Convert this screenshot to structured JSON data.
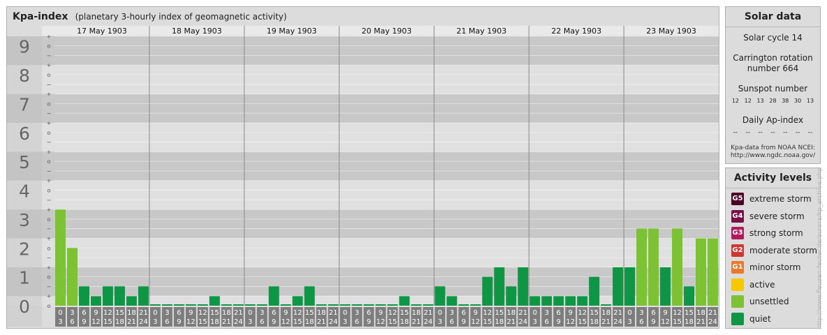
{
  "header": {
    "title": "Kpa-index",
    "subtitle": "(planetary 3-hourly index of geomagnetic activity)"
  },
  "chart_data": {
    "type": "bar",
    "days": [
      "17 May 1903",
      "18 May 1903",
      "19 May 1903",
      "20 May 1903",
      "21 May 1903",
      "22 May 1903",
      "23 May 1903"
    ],
    "hour_labels": [
      [
        "0",
        "3"
      ],
      [
        "3",
        "6"
      ],
      [
        "6",
        "9"
      ],
      [
        "9",
        "12"
      ],
      [
        "12",
        "15"
      ],
      [
        "15",
        "18"
      ],
      [
        "18",
        "21"
      ],
      [
        "21",
        "24"
      ]
    ],
    "y_ticks": [
      "0",
      "1",
      "2",
      "3",
      "4",
      "5",
      "6",
      "7",
      "8",
      "9"
    ],
    "minor_marks": [
      "o",
      "+",
      "−"
    ],
    "ylim": [
      0,
      9.33
    ],
    "values": [
      3.33,
      2.0,
      0.67,
      0.33,
      0.67,
      0.67,
      0.33,
      0.67,
      0,
      0,
      0,
      0,
      0,
      0.33,
      0,
      0,
      0,
      0,
      0.67,
      0,
      0.33,
      0.67,
      0,
      0,
      0,
      0,
      0,
      0,
      0,
      0.33,
      0,
      0,
      0.67,
      0.33,
      0,
      0,
      1.0,
      1.33,
      0.67,
      1.33,
      0.33,
      0.33,
      0.33,
      0.33,
      0.33,
      1.0,
      0,
      1.33,
      1.33,
      2.67,
      2.67,
      1.33,
      2.67,
      0.67,
      2.33,
      2.33
    ],
    "colors": {
      "quiet": "#0e9645",
      "unsettled": "#7cc232",
      "active": "#f7c702",
      "minor": "#e9782e",
      "moderate": "#d0362e",
      "strong": "#b0195c",
      "severe": "#7a0e46",
      "extreme": "#4c0026"
    }
  },
  "solar": {
    "title": "Solar data",
    "cycle": "Solar cycle 14",
    "carrington_1": "Carrington rotation",
    "carrington_2": "number 664",
    "sunspot_title": "Sunspot number",
    "sunspots": [
      "12",
      "12",
      "13",
      "28",
      "38",
      "30",
      "13"
    ],
    "ap_title": "Daily Ap-index",
    "ap_values": [
      "--",
      "--",
      "--",
      "--",
      "--",
      "--",
      "--"
    ],
    "source_1": "Kpa-data from NOAA NCEI:",
    "source_2": "http://www.ngdc.noaa.gov/"
  },
  "levels": {
    "title": "Activity levels",
    "items": [
      {
        "badge": "G5",
        "label": "extreme storm",
        "color": "#4c0026"
      },
      {
        "badge": "G4",
        "label": "severe storm",
        "color": "#7a0e46"
      },
      {
        "badge": "G3",
        "label": "strong storm",
        "color": "#b0195c"
      },
      {
        "badge": "G2",
        "label": "moderate storm",
        "color": "#d0362e"
      },
      {
        "badge": "G1",
        "label": "minor storm",
        "color": "#e9782e"
      },
      {
        "badge": "",
        "label": "active",
        "color": "#f7c702"
      },
      {
        "badge": "",
        "label": "unsettled",
        "color": "#7cc232"
      },
      {
        "badge": "",
        "label": "quiet",
        "color": "#0e9645"
      }
    ]
  },
  "watermark": "http://www.fleuzen-feuter.de/aurora/kp_archive.php"
}
